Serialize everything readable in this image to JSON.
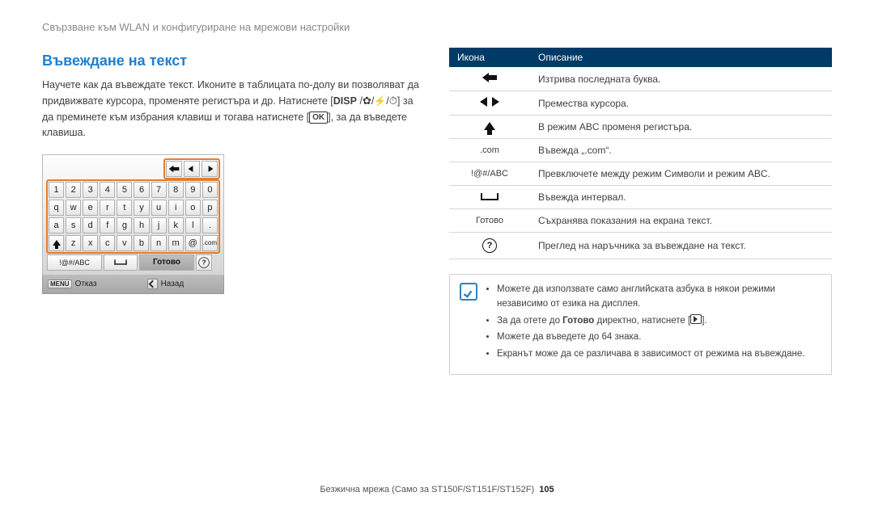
{
  "breadcrumb": "Свързване към WLAN и конфигуриране на мрежови настройки",
  "heading": "Въвеждане на текст",
  "intro": {
    "line1": "Научете как да въвеждате текст. Иконите в таблицата по-долу ви позволяват да придвижвате курсора, променяте регистъра и др. Натиснете [",
    "disp": "DISP",
    "ok": "OK",
    "line2": "] за да преминете към избрания клавиш и тогава натиснете [",
    "line3": "], за да въведете клавиша."
  },
  "keyboard": {
    "row1": [
      "1",
      "2",
      "3",
      "4",
      "5",
      "6",
      "7",
      "8",
      "9",
      "0"
    ],
    "row2": [
      "q",
      "w",
      "e",
      "r",
      "t",
      "y",
      "u",
      "i",
      "o",
      "p"
    ],
    "row3": [
      "a",
      "s",
      "d",
      "f",
      "g",
      "h",
      "j",
      "k",
      "l",
      "."
    ],
    "row4_rest": [
      "z",
      "x",
      "c",
      "v",
      "b",
      "n",
      "m",
      "@",
      ".com"
    ],
    "sym_key": "!@#/ABC",
    "done": "Готово",
    "status_cancel": "Отказ",
    "status_back": "Назад",
    "menu_chip": "MENU"
  },
  "table": {
    "h_icon": "Икона",
    "h_desc": "Описание",
    "rows": [
      {
        "icon_type": "back",
        "desc": "Изтрива последната буква."
      },
      {
        "icon_type": "lr",
        "desc": "Премества курсора."
      },
      {
        "icon_type": "up",
        "desc": "В режим ABC променя регистъра."
      },
      {
        "icon_type": "com",
        "icon_text": ".com",
        "desc": "Въвежда „.com“."
      },
      {
        "icon_type": "sym",
        "icon_text": "!@#/ABC",
        "desc": "Превключете между режим Символи и режим ABC."
      },
      {
        "icon_type": "space",
        "desc": "Въвежда интервал."
      },
      {
        "icon_type": "done",
        "icon_text": "Готово",
        "desc": "Съхранява показания на екрана текст."
      },
      {
        "icon_type": "help",
        "desc": "Преглед на наръчника за въвеждане на текст."
      }
    ]
  },
  "note": {
    "b1": "Можете да използвате само английската азбука в някои режими независимо от езика на дисплея.",
    "b2_a": "За да отете до ",
    "b2_b": "Готово",
    "b2_c": " директно, натиснете [",
    "b2_d": "].",
    "b3": "Можете да въведете до 64 знака.",
    "b4": "Екранът може да се различава в зависимост от режима на въвеждане."
  },
  "footer": {
    "text": "Безжична мрежа (Само за ST150F/ST151F/ST152F)",
    "page": "105"
  }
}
